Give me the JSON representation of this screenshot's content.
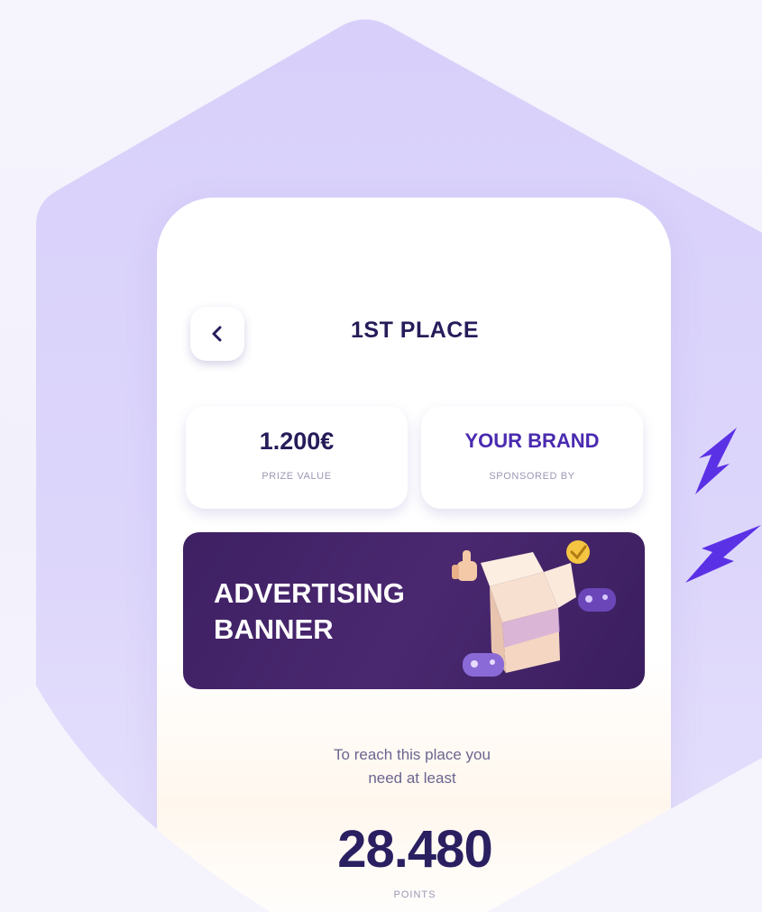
{
  "header": {
    "title": "1ST PLACE",
    "back_icon": "chevron-left-icon"
  },
  "stats": {
    "prize": {
      "value": "1.200€",
      "label": "PRIZE VALUE"
    },
    "sponsor": {
      "value": "YOUR BRAND",
      "label": "SPONSORED BY"
    }
  },
  "banner": {
    "line1": "ADVERTISING",
    "line2": "BANNER"
  },
  "requirement": {
    "line1": "To reach this place you",
    "line2": "need at least",
    "points": "28.480",
    "points_label": "POINTS"
  },
  "colors": {
    "hexagon": "#d9d2fa",
    "title": "#261c5a",
    "brand": "#4a2ab0",
    "banner_bg": "#3e2063",
    "bolt_purple": "#6a3df0",
    "bolt_orange": "#f5a23a"
  }
}
